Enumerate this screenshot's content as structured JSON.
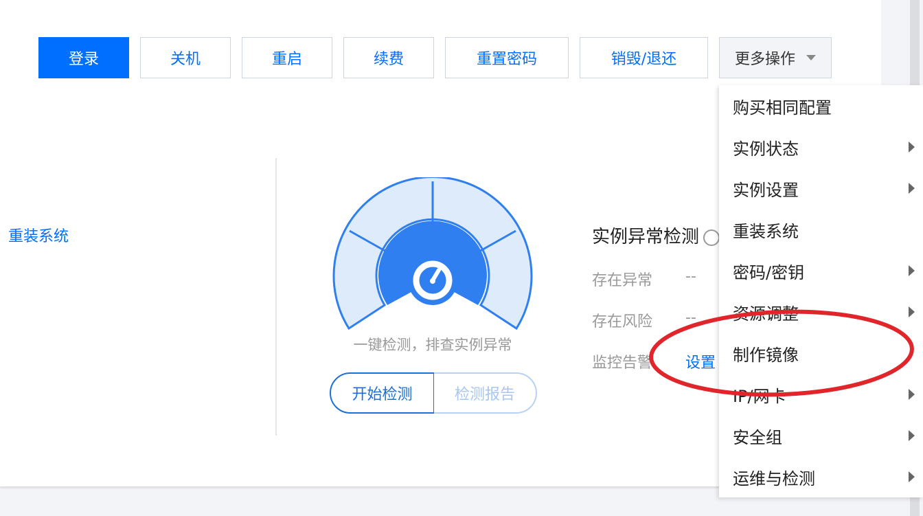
{
  "toolbar": {
    "login": "登录",
    "shutdown": "关机",
    "restart": "重启",
    "renew": "续费",
    "reset_password": "重置密码",
    "destroy_return": "销毁/退还",
    "more_actions": "更多操作"
  },
  "left": {
    "reinstall_link": "重装系统"
  },
  "detection": {
    "caption": "一键检测，排查实例异常",
    "start_button": "开始检测",
    "report_button": "检测报告",
    "title": "实例异常检测",
    "rows": [
      {
        "label": "存在异常",
        "value": "--"
      },
      {
        "label": "存在风险",
        "value": "--"
      },
      {
        "label": "监控告警",
        "link": "设置"
      }
    ]
  },
  "more_menu": {
    "items": [
      {
        "label": "购买相同配置",
        "has_submenu": false
      },
      {
        "label": "实例状态",
        "has_submenu": true
      },
      {
        "label": "实例设置",
        "has_submenu": true
      },
      {
        "label": "重装系统",
        "has_submenu": false
      },
      {
        "label": "密码/密钥",
        "has_submenu": true
      },
      {
        "label": "资源调整",
        "has_submenu": true
      },
      {
        "label": "制作镜像",
        "has_submenu": false
      },
      {
        "label": "IP/网卡",
        "has_submenu": true
      },
      {
        "label": "安全组",
        "has_submenu": true
      },
      {
        "label": "运维与检测",
        "has_submenu": true
      }
    ]
  },
  "colors": {
    "primary": "#006eff",
    "gauge_light": "#deebfb",
    "gauge_dark": "#2f7ff0",
    "annotation": "#e0262a"
  },
  "icons": {
    "gauge": "speedometer-icon",
    "submenu": "caret-right-icon",
    "dropdown": "caret-down-icon"
  }
}
